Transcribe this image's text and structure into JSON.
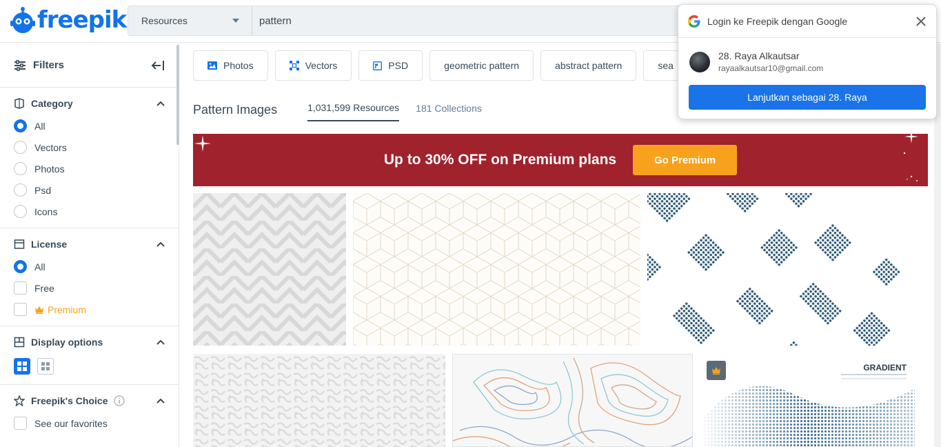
{
  "header": {
    "logo_text": "freepik",
    "search_type": "Resources",
    "search_value": "pattern"
  },
  "sidebar": {
    "filters_title": "Filters",
    "category": {
      "title": "Category",
      "options": [
        {
          "label": "All",
          "selected": true
        },
        {
          "label": "Vectors",
          "selected": false
        },
        {
          "label": "Photos",
          "selected": false
        },
        {
          "label": "Psd",
          "selected": false
        },
        {
          "label": "Icons",
          "selected": false
        }
      ]
    },
    "license": {
      "title": "License",
      "options": [
        {
          "label": "All",
          "selected": true
        },
        {
          "label": "Free",
          "selected": false
        },
        {
          "label": "Premium",
          "selected": false
        }
      ]
    },
    "display_options": {
      "title": "Display options"
    },
    "freepiks_choice": {
      "title": "Freepik's Choice",
      "option": "See our favorites"
    }
  },
  "chips": [
    {
      "label": "Photos",
      "icon": "photo-icon"
    },
    {
      "label": "Vectors",
      "icon": "vector-icon"
    },
    {
      "label": "PSD",
      "icon": "psd-icon"
    },
    {
      "label": "geometric pattern"
    },
    {
      "label": "abstract pattern"
    },
    {
      "label": "sea"
    }
  ],
  "results": {
    "title": "Pattern Images",
    "tabs": [
      {
        "label": "1,031,599 Resources",
        "active": true
      },
      {
        "label": "181 Collections",
        "active": false
      }
    ]
  },
  "banner": {
    "text": "Up to 30% OFF on Premium plans",
    "button": "Go Premium",
    "bg_color": "#a0222c",
    "button_color": "#f8a11c"
  },
  "thumbnails": [
    {
      "name": "grey-chevron-pattern"
    },
    {
      "name": "gold-cube-pattern"
    },
    {
      "name": "blue-halftone-squares"
    },
    {
      "name": "grey-maze-pattern"
    },
    {
      "name": "topographic-lines"
    },
    {
      "name": "gradient-dots-wave",
      "premium": true,
      "text": "GRADIENT"
    }
  ],
  "google_popup": {
    "title": "Login ke Freepik dengan Google",
    "account_name": "28. Raya Alkautsar",
    "account_email": "rayaalkautsar10@gmail.com",
    "continue_button": "Lanjutkan sebagai 28. Raya",
    "button_color": "#1a73e8"
  },
  "accent_color": "#1273eb"
}
